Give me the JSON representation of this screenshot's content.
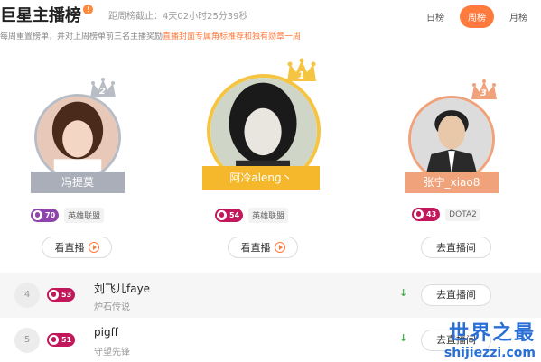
{
  "header": {
    "title": "巨星主播榜",
    "info_icon": "!",
    "countdown": "距周榜截止：4天02小时25分39秒"
  },
  "tabs": [
    {
      "label": "日榜",
      "active": false
    },
    {
      "label": "周榜",
      "active": true
    },
    {
      "label": "月榜",
      "active": false
    }
  ],
  "rule": {
    "prefix": "每周重置榜单，并对上周榜单前三名主播奖励",
    "highlight": "直播封面专属角标推荐和独有勋章一周"
  },
  "podium": [
    {
      "rank": "1",
      "name": "阿冷aleng丶",
      "level": "54",
      "game": "英雄联盟",
      "action": "看直播",
      "ribbon_color": "#f5b72b",
      "crown_color": "#f5c542"
    },
    {
      "rank": "2",
      "name": "冯提莫",
      "level": "70",
      "game": "英雄联盟",
      "action": "看直播",
      "ribbon_color": "#a9aeb8",
      "crown_color": "#b8bcc4"
    },
    {
      "rank": "3",
      "name": "张宁_xiao8",
      "level": "43",
      "game": "DOTA2",
      "action": "去直播间",
      "ribbon_color": "#f0a27a",
      "crown_color": "#f0a27a"
    }
  ],
  "list": [
    {
      "rank": "4",
      "name": "刘飞儿faye",
      "level": "53",
      "game": "炉石传说",
      "trend": "↓",
      "action": "去直播间"
    },
    {
      "rank": "5",
      "name": "pigff",
      "level": "51",
      "game": "守望先锋",
      "trend": "↓",
      "action": "去直播间"
    }
  ],
  "watermark": {
    "main": "世界之最",
    "sub": "shijiezzi.com"
  },
  "colors": {
    "accent": "#ff7a3d",
    "level_badge": "#c2185b",
    "level_badge_purple": "#8e44ad"
  }
}
